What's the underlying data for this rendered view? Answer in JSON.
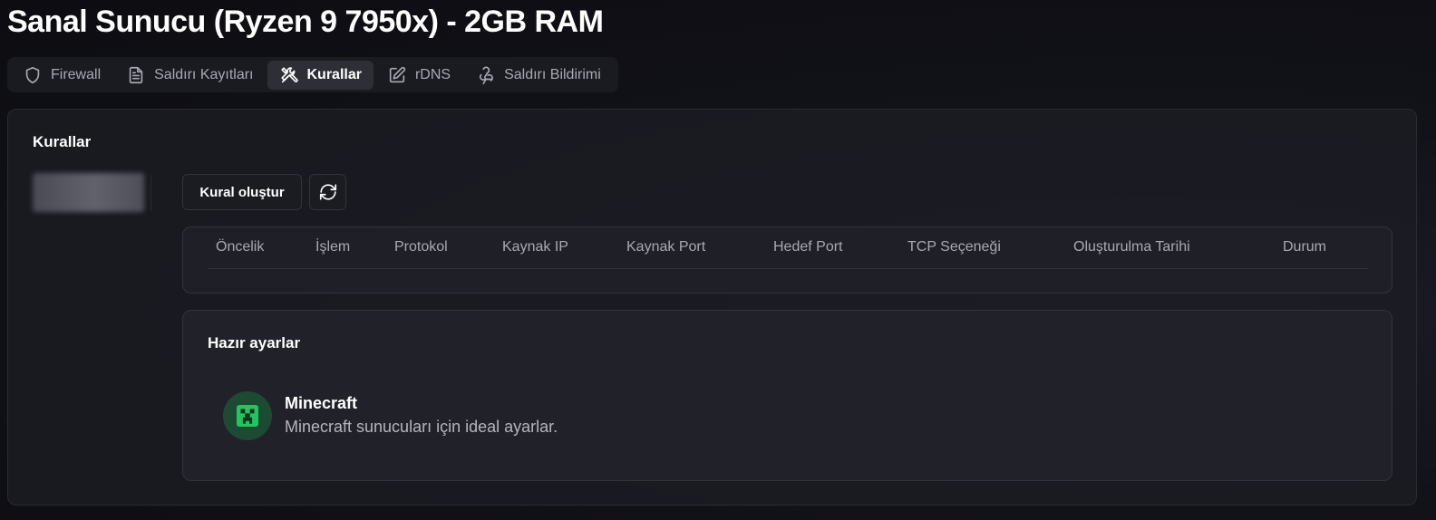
{
  "page": {
    "title": "Sanal Sunucu (Ryzen 9 7950x) - 2GB RAM"
  },
  "tabs": [
    {
      "label": "Firewall",
      "icon": "shield-icon",
      "active": false
    },
    {
      "label": "Saldırı Kayıtları",
      "icon": "document-icon",
      "active": false
    },
    {
      "label": "Kurallar",
      "icon": "tools-icon",
      "active": true
    },
    {
      "label": "rDNS",
      "icon": "edit-icon",
      "active": false
    },
    {
      "label": "Saldırı Bildirimi",
      "icon": "webhook-icon",
      "active": false
    }
  ],
  "rules": {
    "title": "Kurallar",
    "create_button": "Kural oluştur",
    "refresh_icon": "refresh-icon",
    "table": {
      "columns": [
        "Öncelik",
        "İşlem",
        "Protokol",
        "Kaynak IP",
        "Kaynak Port",
        "Hedef Port",
        "TCP Seçeneği",
        "Oluşturulma Tarihi",
        "Durum"
      ],
      "rows": []
    }
  },
  "presets": {
    "title": "Hazır ayarlar",
    "items": [
      {
        "name": "Minecraft",
        "description": "Minecraft sunucuları için ideal ayarlar.",
        "icon": "creeper-icon"
      }
    ]
  },
  "colors": {
    "background": "#0d0d12",
    "card": "#1c1c24",
    "active_tab": "#2e2e37",
    "minecraft_icon_bg": "#1d4a33",
    "minecraft_icon_fg": "#22c55e"
  }
}
